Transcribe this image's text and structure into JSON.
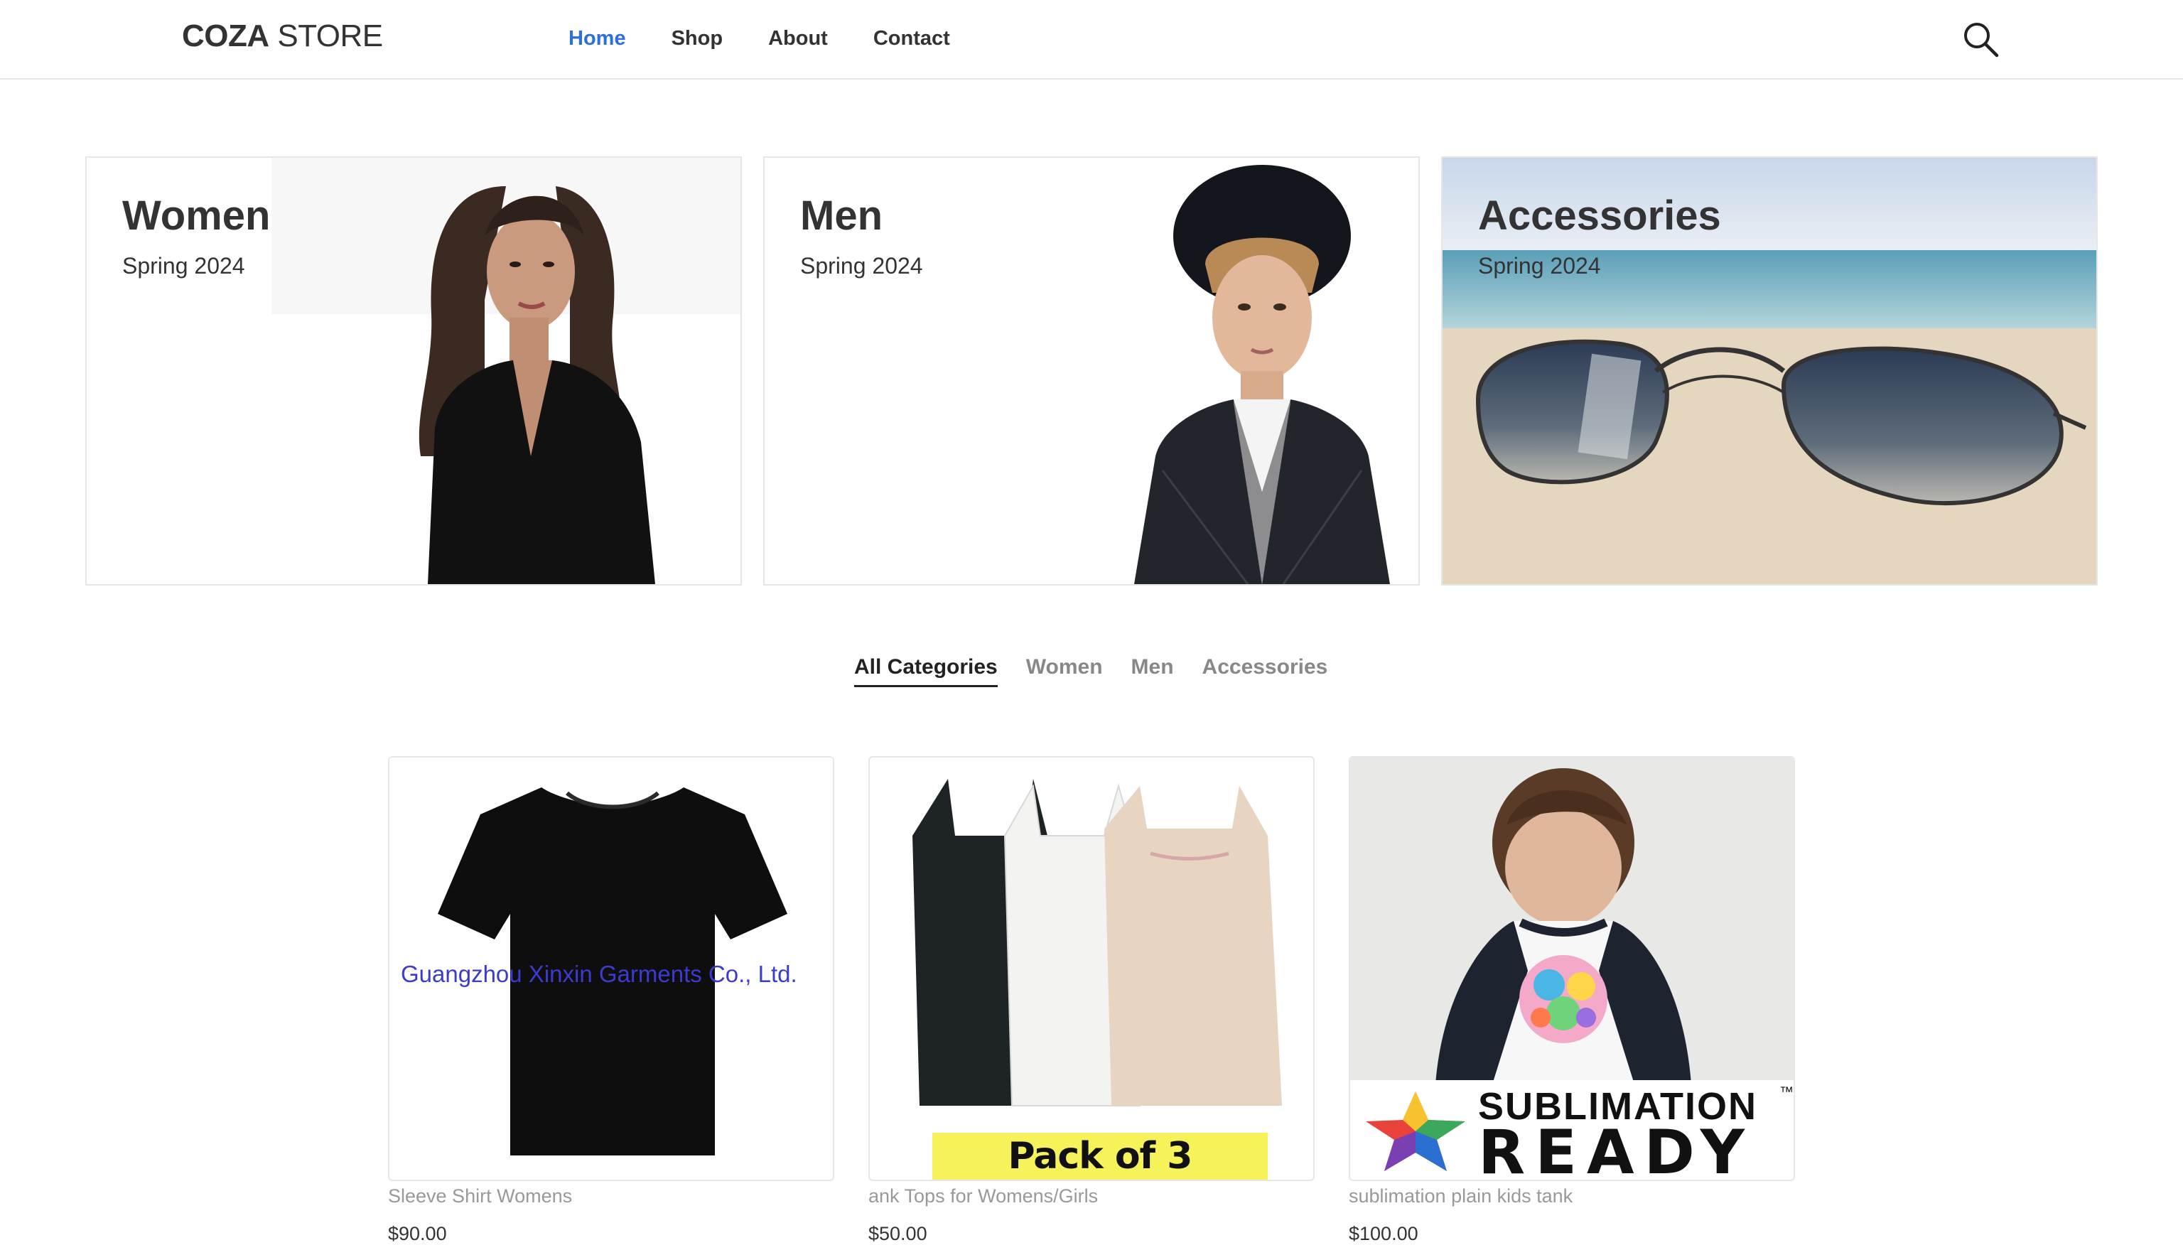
{
  "brand": {
    "bold": "COZA",
    "light": " STORE"
  },
  "nav": [
    {
      "label": "Home",
      "active": true
    },
    {
      "label": "Shop"
    },
    {
      "label": "About"
    },
    {
      "label": "Contact"
    }
  ],
  "icons": {
    "search": "search-icon"
  },
  "accent_color": "#2d6fdb",
  "banners": [
    {
      "title": "Women",
      "subtitle": "Spring 2024"
    },
    {
      "title": "Men",
      "subtitle": "Spring 2024"
    },
    {
      "title": "Accessories",
      "subtitle": "Spring 2024"
    }
  ],
  "filters": [
    {
      "label": "All Categories",
      "active": true
    },
    {
      "label": "Women"
    },
    {
      "label": "Men"
    },
    {
      "label": "Accessories"
    }
  ],
  "products": [
    {
      "name": "Sleeve Shirt Womens",
      "price": "$90.00",
      "watermark": "Guangzhou Xinxin Garments Co., Ltd."
    },
    {
      "name": "ank Tops for Womens/Girls",
      "price": "$50.00",
      "badge": "Pack of 3"
    },
    {
      "name": "sublimation plain kids tank",
      "price": "$100.00",
      "badge_line1": "SUBLIMATION",
      "badge_line2": "READY",
      "tm": "™"
    }
  ]
}
